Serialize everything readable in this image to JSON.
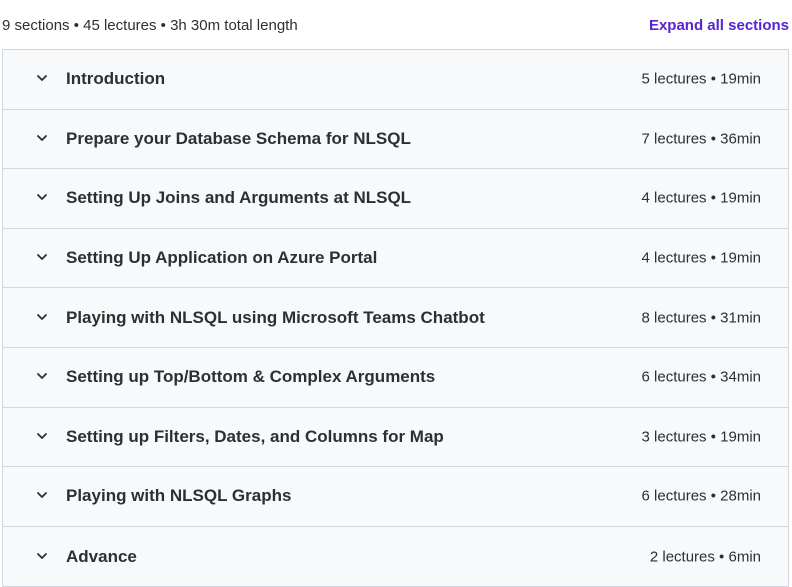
{
  "header": {
    "summary": "9 sections • 45 lectures • 3h 30m total length",
    "expand_all_label": "Expand all sections"
  },
  "sections": [
    {
      "title": "Introduction",
      "meta": "5 lectures • 19min"
    },
    {
      "title": "Prepare your Database Schema for NLSQL",
      "meta": "7 lectures • 36min"
    },
    {
      "title": "Setting Up Joins and Arguments at NLSQL",
      "meta": "4 lectures • 19min"
    },
    {
      "title": "Setting Up Application on Azure Portal",
      "meta": "4 lectures • 19min"
    },
    {
      "title": "Playing with NLSQL using Microsoft Teams Chatbot",
      "meta": "8 lectures • 31min"
    },
    {
      "title": "Setting up Top/Bottom & Complex Arguments",
      "meta": "6 lectures • 34min"
    },
    {
      "title": "Setting up Filters, Dates, and Columns for Map",
      "meta": "3 lectures • 19min"
    },
    {
      "title": "Playing with NLSQL Graphs",
      "meta": "6 lectures • 28min"
    },
    {
      "title": "Advance",
      "meta": "2 lectures • 6min"
    }
  ],
  "icons": {
    "section_toggle": "chevron-down-icon"
  },
  "colors": {
    "accent": "#5624d0",
    "text": "#2d2f31",
    "section_bg": "#f7f9fa",
    "border": "#d1d7dc"
  }
}
